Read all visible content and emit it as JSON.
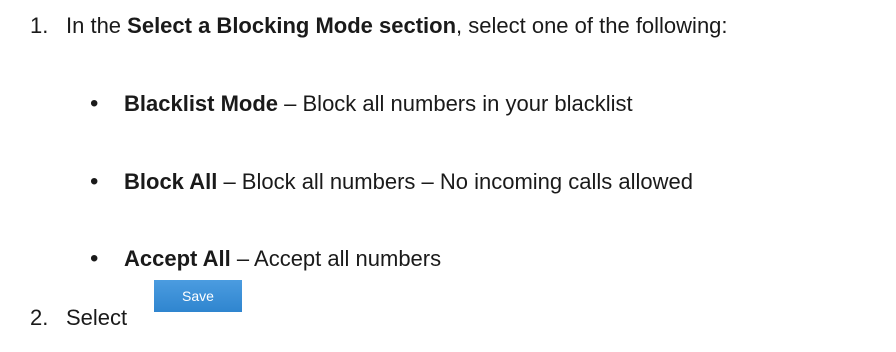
{
  "steps": [
    {
      "number": "1.",
      "text_before": "In the ",
      "bold": "Select a Blocking Mode section",
      "text_after": ", select one of the following:"
    },
    {
      "number": "2.",
      "text": "Select"
    }
  ],
  "options": [
    {
      "bullet": "•",
      "name": "Blacklist Mode",
      "description": " – Block all numbers in your blacklist"
    },
    {
      "bullet": "•",
      "name": "Block All",
      "description": " – Block all numbers – No incoming calls allowed"
    },
    {
      "bullet": "•",
      "name": "Accept All",
      "description": " – Accept all numbers"
    }
  ],
  "save_button": {
    "label": "Save",
    "color": "#3a8fd6"
  }
}
